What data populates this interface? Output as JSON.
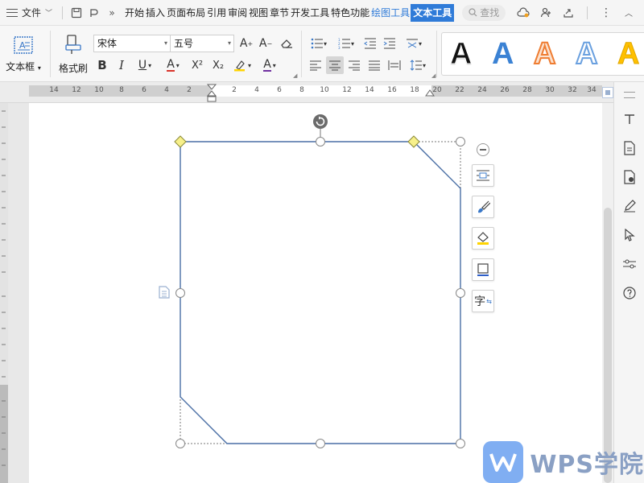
{
  "menubar": {
    "file_label": "文件",
    "tabs": [
      "开始",
      "插入",
      "页面布局",
      "引用",
      "审阅",
      "视图",
      "章节",
      "开发工具",
      "特色功能",
      "绘图工具",
      "文本工具"
    ],
    "active_blue_tab": "绘图工具",
    "active_fill_tab": "文本工具",
    "search_placeholder": "查找"
  },
  "ribbon": {
    "textbox_label": "文本框",
    "format_painter_label": "格式刷",
    "font_name": "宋体",
    "font_size": "五号",
    "bold": "B",
    "italic": "I",
    "underline": "U",
    "font_color_glyph": "A",
    "superscript": "X²",
    "subscript": "X₂",
    "text_color_glyph": "A",
    "grow_font": "A⁺",
    "shrink_font": "A⁻",
    "colors": {
      "accent_blue": "#2f7bd8",
      "font_color_red": "#d9342b",
      "text_color_purple": "#7030a0",
      "highlight_yellow": "#ffd400"
    },
    "wordart": [
      {
        "glyph": "A",
        "style": "black-fill"
      },
      {
        "glyph": "A",
        "style": "blue-fill"
      },
      {
        "glyph": "A",
        "style": "orange-outline"
      },
      {
        "glyph": "A",
        "style": "blue-outline"
      },
      {
        "glyph": "A",
        "style": "yellow-fill"
      }
    ]
  },
  "ruler": {
    "numbers": [
      "14",
      "12",
      "10",
      "8",
      "6",
      "4",
      "2",
      "2",
      "4",
      "6",
      "8",
      "10",
      "12",
      "14",
      "16",
      "18",
      "20",
      "22",
      "24",
      "26",
      "28",
      "30",
      "32",
      "34"
    ]
  },
  "shape": {
    "type": "snip-corner-rectangle",
    "stroke": "#4a6fa5"
  },
  "float_tools": [
    "layout-options-icon",
    "shape-style-icon",
    "fill-icon",
    "outline-icon",
    "text-direction-icon"
  ],
  "float_tools_last_glyph": "字",
  "sidebar": [
    "text-icon",
    "document-icon",
    "document-settings-icon",
    "pen-icon",
    "select-icon",
    "adjust-icon",
    "help-icon"
  ],
  "watermark": {
    "text": "WPS学院"
  }
}
